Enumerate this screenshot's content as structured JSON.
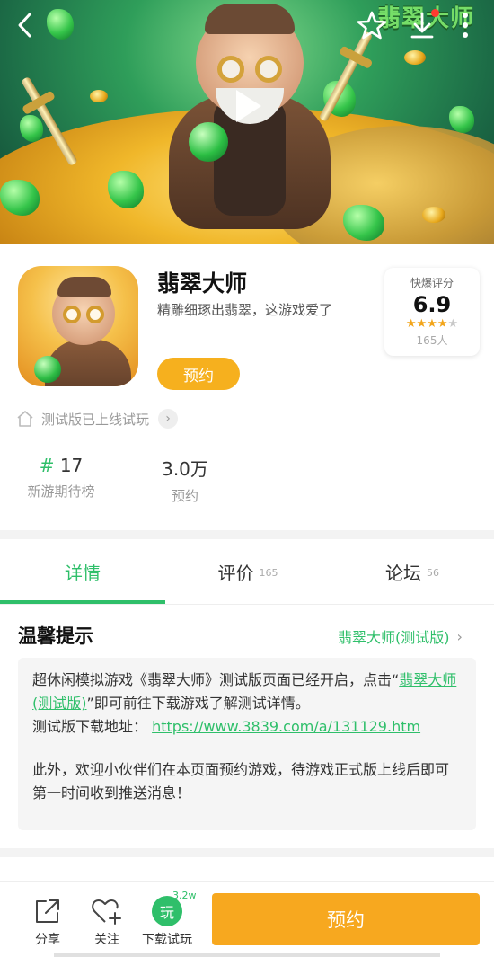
{
  "hero": {
    "logo_text": "翡翠大师"
  },
  "app": {
    "name": "翡翠大师",
    "tagline": "精雕细琢出翡翠，这游戏爱了",
    "reserve_label": "预约"
  },
  "rating": {
    "label": "快爆评分",
    "score": "6.9",
    "stars_filled": 3.5,
    "stars_total": 5,
    "count": "165人"
  },
  "beta": {
    "text": "测试版已上线试玩"
  },
  "stats": {
    "rank": {
      "hash": "#",
      "value": "17",
      "label": "新游期待榜"
    },
    "reserve": {
      "value": "3.0万",
      "label": "预约"
    }
  },
  "tabs": [
    {
      "label": "详情",
      "count": ""
    },
    {
      "label": "评价",
      "count": "165"
    },
    {
      "label": "论坛",
      "count": "56"
    }
  ],
  "notice": {
    "title": "温馨提示",
    "link": "翡翠大师(测试版)",
    "line1_prefix": "超休闲模拟游戏《翡翠大师》测试版页面已经开启，点击“",
    "line1_link": "翡翠大师(测试版)",
    "line1_suffix": "”即可前往下载游戏了解测试详情。",
    "line2_prefix": "测试版下载地址：",
    "line2_url": "https://www.3839.com/a/131129.htm",
    "dashes": "------------------------------------------------------------",
    "line3": "此外，欢迎小伙伴们在本页面预约游戏，待游戏正式版上线后即可第一时间收到推送消息！"
  },
  "bottom": {
    "share_label": "分享",
    "follow_label": "关注",
    "play_glyph": "玩",
    "play_label": "下载试玩",
    "play_badge": "3.2w",
    "reserve_label": "预约"
  },
  "colors": {
    "accent_green": "#2fbf6a",
    "button_orange": "#f7a81f",
    "star": "#f2a51b"
  }
}
